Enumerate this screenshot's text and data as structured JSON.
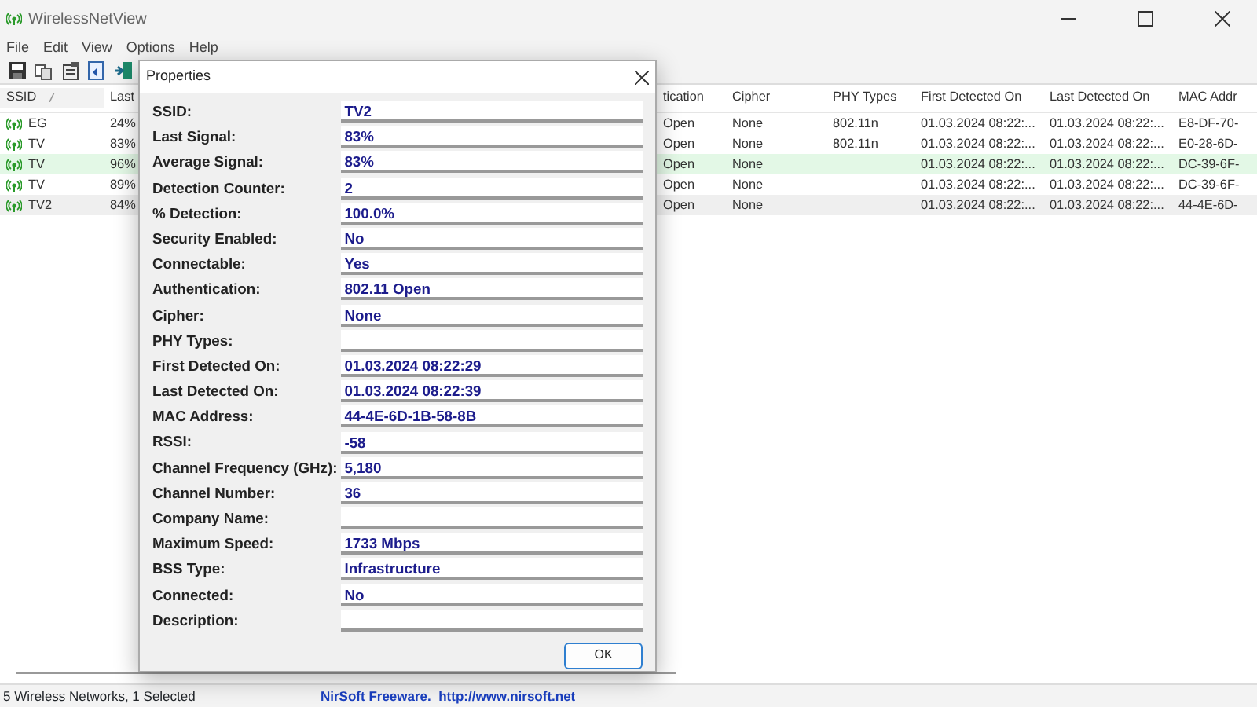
{
  "window": {
    "title": "WirelessNetView"
  },
  "menu": [
    "File",
    "Edit",
    "View",
    "Options",
    "Help"
  ],
  "table": {
    "columns": [
      {
        "label": "SSID",
        "sorted": true
      },
      {
        "label": "Last",
        "sorted": false
      },
      {
        "label": "tication",
        "sorted": false
      },
      {
        "label": "Cipher",
        "sorted": false
      },
      {
        "label": "PHY Types",
        "sorted": false
      },
      {
        "label": "First Detected On",
        "sorted": false
      },
      {
        "label": "Last Detected On",
        "sorted": false
      },
      {
        "label": "MAC Addr",
        "sorted": false
      }
    ],
    "rows": [
      {
        "cells": [
          "EG",
          "24%",
          "Open",
          "None",
          "802.11n",
          "01.03.2024 08:22:...",
          "01.03.2024 08:22:...",
          "E8-DF-70-"
        ],
        "connected": false,
        "selected": false
      },
      {
        "cells": [
          "TV",
          "83%",
          "Open",
          "None",
          "802.11n",
          "01.03.2024 08:22:...",
          "01.03.2024 08:22:...",
          "E0-28-6D-"
        ],
        "connected": false,
        "selected": false
      },
      {
        "cells": [
          "TV",
          "96%",
          "Open",
          "None",
          null,
          "01.03.2024 08:22:...",
          "01.03.2024 08:22:...",
          "DC-39-6F-"
        ],
        "connected": true,
        "selected": false
      },
      {
        "cells": [
          "TV",
          "89%",
          "Open",
          "None",
          null,
          "01.03.2024 08:22:...",
          "01.03.2024 08:22:...",
          "DC-39-6F-"
        ],
        "connected": false,
        "selected": false
      },
      {
        "cells": [
          "TV2",
          "84%",
          "Open",
          "None",
          null,
          "01.03.2024 08:22:...",
          "01.03.2024 08:22:...",
          "44-4E-6D-"
        ],
        "connected": false,
        "selected": true
      }
    ]
  },
  "dialog": {
    "title": "Properties",
    "fields": [
      {
        "label": "SSID:",
        "value": "TV2"
      },
      {
        "label": "Last Signal:",
        "value": "83%"
      },
      {
        "label": "Average Signal:",
        "value": "83%"
      },
      {
        "label": "Detection Counter:",
        "value": "2"
      },
      {
        "label": "% Detection:",
        "value": "100.0%"
      },
      {
        "label": "Security Enabled:",
        "value": "No"
      },
      {
        "label": "Connectable:",
        "value": "Yes"
      },
      {
        "label": "Authentication:",
        "value": "802.11 Open"
      },
      {
        "label": "Cipher:",
        "value": "None"
      },
      {
        "label": "PHY Types:"
      },
      {
        "label": "First Detected On:",
        "value": "01.03.2024 08:22:29"
      },
      {
        "label": "Last Detected On:",
        "value": "01.03.2024 08:22:39"
      },
      {
        "label": "MAC Address:",
        "value": "44-4E-6D-1B-58-8B"
      },
      {
        "label": "RSSI:",
        "value": "-58"
      },
      {
        "label": "Channel Frequency (GHz):",
        "value": "5,180"
      },
      {
        "label": "Channel Number:",
        "value": "36"
      },
      {
        "label": "Company Name:"
      },
      {
        "label": "Maximum Speed:",
        "value": "1733 Mbps"
      },
      {
        "label": "BSS Type:",
        "value": "Infrastructure"
      },
      {
        "label": "Connected:",
        "value": "No"
      },
      {
        "label": "Description:"
      }
    ],
    "button": "OK"
  },
  "status_bar": {
    "count": "5 Wireless Networks, 1 Selected",
    "credit": "NirSoft Freeware.  http://www.nirsoft.net"
  }
}
